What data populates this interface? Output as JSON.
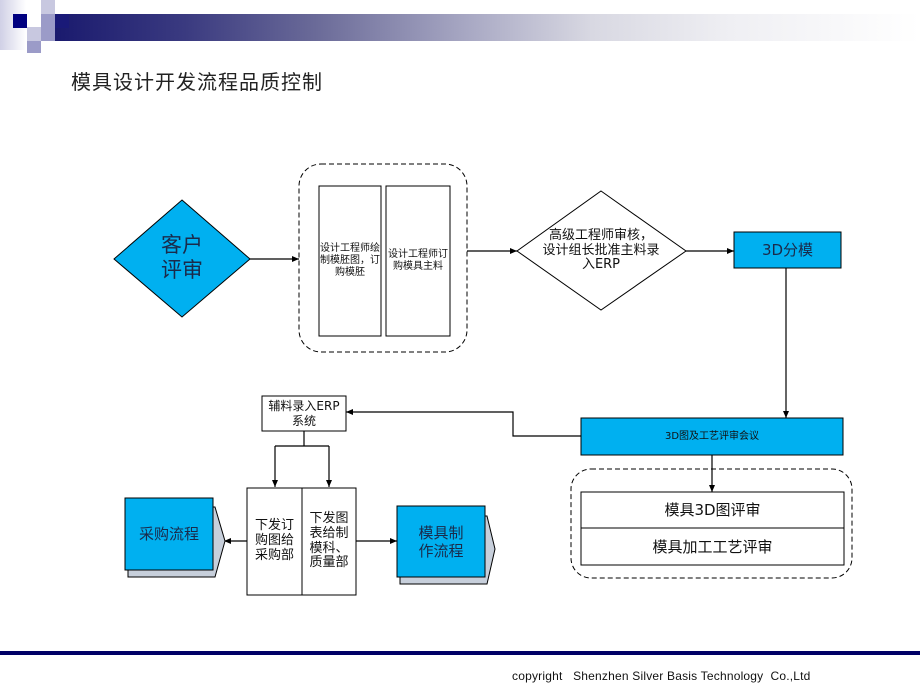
{
  "slide": {
    "title": "模具设计开发流程品质控制",
    "footer": "copyright   Shenzhen Silver Basis Technology  Co.,Ltd",
    "colors": {
      "accent_blue": "#00B0F0",
      "navy": "#000066",
      "shadow": "#C7CFDB"
    }
  },
  "flow": {
    "customer_review": "客户\n评审",
    "design_box_1": "设计工程师绘制模胚图，订购模胚",
    "design_box_2": "设计工程师订购模具主料",
    "senior_review": "高级工程师审核，\n设计组长批准主料录\n入ERP",
    "split_3d": "3D分模",
    "review_meeting": "3D图及工艺评审会议",
    "review_3d": "模具3D图评审",
    "review_process": "模具加工工艺评审",
    "aux_material": "辅料录入ERP\n系统",
    "issue_purchase": "下发订\n购图给\n采购部",
    "issue_drawings": "下发图\n表给制\n模科、\n质量部",
    "purchase_flow": "采购流程",
    "mold_flow": "模具制\n作流程"
  }
}
